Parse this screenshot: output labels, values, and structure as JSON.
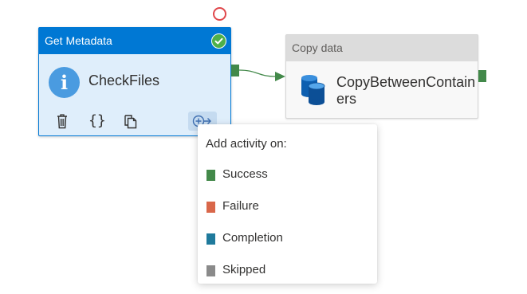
{
  "activities": [
    {
      "type_label": "Get Metadata",
      "name": "CheckFiles",
      "status": "succeeded"
    },
    {
      "type_label": "Copy data",
      "name": "CopyBetweenContainers"
    }
  ],
  "popup": {
    "title": "Add activity on:",
    "items": [
      {
        "label": "Success",
        "color": "#43894a"
      },
      {
        "label": "Failure",
        "color": "#d9674a"
      },
      {
        "label": "Completion",
        "color": "#1f7a9c"
      },
      {
        "label": "Skipped",
        "color": "#8a8a8a"
      }
    ]
  },
  "icons": {
    "status_circle": "red-circle-icon",
    "success": "checkmark-icon",
    "info": "info-icon",
    "delete": "trash-icon",
    "code": "code-braces-icon",
    "clone": "copy-icon",
    "add_output": "add-output-icon",
    "copy_activity": "database-copy-icon"
  },
  "colors": {
    "accent": "#0078d4",
    "success": "#43894a"
  }
}
